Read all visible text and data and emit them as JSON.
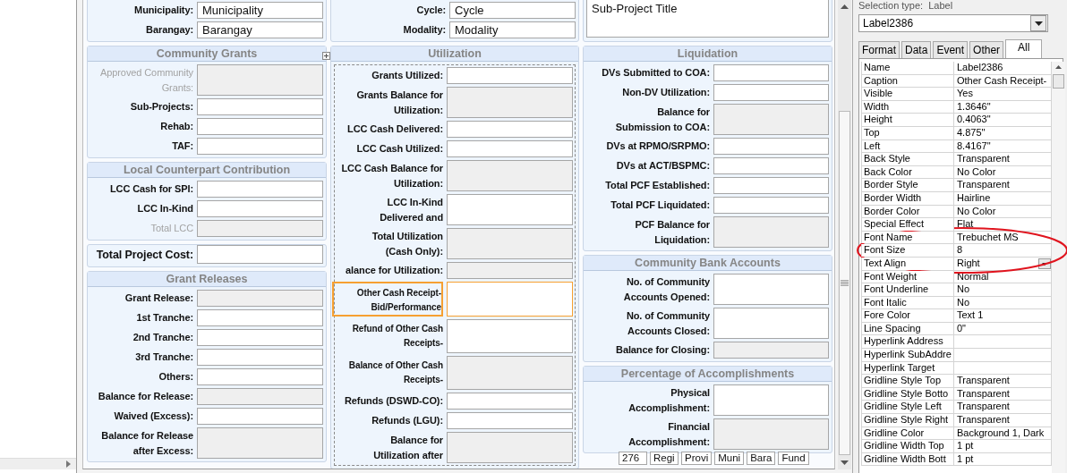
{
  "form": {
    "columns": [
      {
        "sections": [
          {
            "kind": "top",
            "subform": false,
            "rows": [
              {
                "label": "Municipality:",
                "kind": "normal",
                "field": {
                  "kind": "input",
                  "value": "Municipality"
                },
                "disabled": false,
                "selected": false
              },
              {
                "label": "Barangay:",
                "kind": "normal",
                "field": {
                  "kind": "input",
                  "value": "Barangay"
                },
                "disabled": false,
                "selected": false
              }
            ]
          },
          {
            "title": "Community Grants",
            "kind": "group",
            "subform": false,
            "rows": [
              {
                "label": "Approved Community\nGrants:",
                "kind": "normal",
                "field": {
                  "kind": "computed"
                },
                "disabled": true,
                "selected": false
              },
              {
                "label": "Sub-Projects:",
                "kind": "normal",
                "field": {
                  "kind": "input"
                },
                "disabled": false,
                "selected": false
              },
              {
                "label": "Rehab:",
                "kind": "normal",
                "field": {
                  "kind": "input"
                },
                "disabled": false,
                "selected": false
              },
              {
                "label": "TAF:",
                "kind": "normal",
                "field": {
                  "kind": "input"
                },
                "disabled": false,
                "selected": false
              }
            ]
          },
          {
            "title": "Local Counterpart Contribution",
            "kind": "group",
            "subform": false,
            "rows": [
              {
                "label": "LCC Cash for SPI:",
                "kind": "normal",
                "field": {
                  "kind": "input"
                },
                "disabled": false,
                "selected": false
              },
              {
                "label": "LCC In-Kind",
                "kind": "normal",
                "field": {
                  "kind": "input"
                },
                "disabled": false,
                "selected": false
              },
              {
                "label": "Total LCC",
                "kind": "normal",
                "field": {
                  "kind": "computed"
                },
                "disabled": true,
                "selected": false
              }
            ]
          },
          {
            "kind": "group",
            "subform": false,
            "rows": [
              {
                "label": "Total Project Cost:",
                "kind": "total",
                "field": {
                  "kind": "input"
                },
                "disabled": false,
                "selected": false
              }
            ]
          },
          {
            "title": "Grant Releases",
            "kind": "group",
            "subform": false,
            "rows": [
              {
                "label": "Grant Release:",
                "kind": "normal",
                "field": {
                  "kind": "computed"
                },
                "disabled": false,
                "selected": false
              },
              {
                "label": "1st Tranche:",
                "kind": "normal",
                "field": {
                  "kind": "input"
                },
                "disabled": false,
                "selected": false
              },
              {
                "label": "2nd Tranche:",
                "kind": "normal",
                "field": {
                  "kind": "input"
                },
                "disabled": false,
                "selected": false
              },
              {
                "label": "3rd Tranche:",
                "kind": "normal",
                "field": {
                  "kind": "input"
                },
                "disabled": false,
                "selected": false
              },
              {
                "label": "Others:",
                "kind": "normal",
                "field": {
                  "kind": "input"
                },
                "disabled": false,
                "selected": false
              },
              {
                "label": "Balance for Release:",
                "kind": "normal",
                "field": {
                  "kind": "computed"
                },
                "disabled": false,
                "selected": false
              },
              {
                "label": "Waived (Excess):",
                "kind": "normal",
                "field": {
                  "kind": "input"
                },
                "disabled": false,
                "selected": false
              },
              {
                "label": "Balance for Release\nafter Excess:",
                "kind": "normal",
                "field": {
                  "kind": "computed"
                },
                "disabled": false,
                "selected": false
              }
            ]
          }
        ]
      },
      {
        "sections": [
          {
            "kind": "top",
            "subform": false,
            "rows": [
              {
                "label": "Cycle:",
                "kind": "normal",
                "field": {
                  "kind": "input",
                  "value": "Cycle"
                },
                "disabled": false,
                "selected": false
              },
              {
                "label": "Modality:",
                "kind": "normal",
                "field": {
                  "kind": "input",
                  "value": "Modality"
                },
                "disabled": false,
                "selected": false
              }
            ]
          },
          {
            "title": "Utilization",
            "kind": "group",
            "subform": true,
            "rows": [
              {
                "label": "Grants Utilized:",
                "kind": "normal",
                "field": {
                  "kind": "input"
                },
                "disabled": false,
                "selected": false
              },
              {
                "label": "Grants Balance for\nUtilization:",
                "kind": "normal",
                "field": {
                  "kind": "computed"
                },
                "disabled": false,
                "selected": false
              },
              {
                "label": "LCC Cash Delivered:",
                "kind": "normal",
                "field": {
                  "kind": "input"
                },
                "disabled": false,
                "selected": false
              },
              {
                "label": "LCC Cash Utilized:",
                "kind": "normal",
                "field": {
                  "kind": "input"
                },
                "disabled": false,
                "selected": false
              },
              {
                "label": "LCC Cash Balance for\nUtilization:",
                "kind": "normal",
                "field": {
                  "kind": "computed"
                },
                "disabled": false,
                "selected": false
              },
              {
                "label": "LCC In-Kind\nDelivered and",
                "kind": "normal",
                "field": {
                  "kind": "input"
                },
                "disabled": false,
                "selected": false
              },
              {
                "label": "Total Utilization\n(Cash Only):",
                "kind": "normal",
                "field": {
                  "kind": "computed"
                },
                "disabled": false,
                "selected": false
              },
              {
                "label": "alance for Utilization:",
                "kind": "normal",
                "field": {
                  "kind": "computed"
                },
                "disabled": false,
                "selected": false
              },
              {
                "label": "Other Cash Receipt-\nBid/Performance",
                "kind": "small",
                "field": {
                  "kind": "input"
                },
                "disabled": false,
                "selected": true
              },
              {
                "label": "Refund of Other Cash\nReceipts-",
                "kind": "small",
                "field": {
                  "kind": "input"
                },
                "disabled": false,
                "selected": false
              },
              {
                "label": "Balance of Other Cash\nReceipts-",
                "kind": "small",
                "field": {
                  "kind": "computed"
                },
                "disabled": false,
                "selected": false
              },
              {
                "label": "Refunds (DSWD-CO):",
                "kind": "normal",
                "field": {
                  "kind": "input"
                },
                "disabled": false,
                "selected": false
              },
              {
                "label": "Refunds (LGU):",
                "kind": "normal",
                "field": {
                  "kind": "input"
                },
                "disabled": false,
                "selected": false
              },
              {
                "label": "Balance for\nUtilization after",
                "kind": "normal",
                "field": {
                  "kind": "computed"
                },
                "disabled": false,
                "selected": false
              }
            ]
          }
        ]
      },
      {
        "sections": [
          {
            "kind": "top",
            "subform": false,
            "rows": [
              {
                "field": {
                  "kind": "textarea",
                  "value": "Sub-Project Title"
                },
                "disabled": false,
                "selected": false
              }
            ]
          },
          {
            "title": "Liquidation",
            "kind": "group",
            "subform": false,
            "rows": [
              {
                "label": "DVs Submitted to COA:",
                "kind": "normal",
                "field": {
                  "kind": "input"
                },
                "disabled": false,
                "selected": false
              },
              {
                "label": "Non-DV Utilization:",
                "kind": "normal",
                "field": {
                  "kind": "input"
                },
                "disabled": false,
                "selected": false
              },
              {
                "label": "Balance for\nSubmission to COA:",
                "kind": "normal",
                "field": {
                  "kind": "computed"
                },
                "disabled": false,
                "selected": false
              },
              {
                "label": "DVs at RPMO/SRPMO:",
                "kind": "normal",
                "field": {
                  "kind": "input"
                },
                "disabled": false,
                "selected": false
              },
              {
                "label": "DVs at ACT/BSPMC:",
                "kind": "normal",
                "field": {
                  "kind": "input"
                },
                "disabled": false,
                "selected": false
              },
              {
                "label": "Total PCF Established:",
                "kind": "normal",
                "field": {
                  "kind": "input"
                },
                "disabled": false,
                "selected": false
              },
              {
                "label": "Total PCF Liquidated:",
                "kind": "normal",
                "field": {
                  "kind": "input"
                },
                "disabled": false,
                "selected": false
              },
              {
                "label": "PCF Balance for\nLiquidation:",
                "kind": "normal",
                "field": {
                  "kind": "computed"
                },
                "disabled": false,
                "selected": false
              }
            ]
          },
          {
            "title": "Community Bank Accounts",
            "kind": "group",
            "subform": false,
            "rows": [
              {
                "label": "No. of Community\nAccounts Opened:",
                "kind": "normal",
                "field": {
                  "kind": "input"
                },
                "disabled": false,
                "selected": false
              },
              {
                "label": "No. of Community\nAccounts Closed:",
                "kind": "normal",
                "field": {
                  "kind": "input"
                },
                "disabled": false,
                "selected": false
              },
              {
                "label": "Balance for Closing:",
                "kind": "normal",
                "field": {
                  "kind": "computed"
                },
                "disabled": false,
                "selected": false
              }
            ]
          },
          {
            "title": "Percentage of Accomplishments",
            "kind": "group",
            "subform": false,
            "rows": [
              {
                "label": "Physical\nAccomplishment:",
                "kind": "normal",
                "field": {
                  "kind": "input"
                },
                "disabled": false,
                "selected": false
              },
              {
                "label": "Financial\nAccomplishment:",
                "kind": "normal",
                "field": {
                  "kind": "computed"
                },
                "disabled": false,
                "selected": false
              }
            ]
          }
        ],
        "footer_fields": [
          "276",
          "Regi",
          "Provi",
          "Muni",
          "Bara",
          "Fund"
        ]
      }
    ]
  },
  "property_sheet": {
    "selection_type_label": "Selection type:",
    "selection_type": "Label",
    "object": "Label2386",
    "tabs": [
      {
        "label": "Format",
        "selected": false
      },
      {
        "label": "Data",
        "selected": false
      },
      {
        "label": "Event",
        "selected": false
      },
      {
        "label": "Other",
        "selected": false
      },
      {
        "label": "All",
        "selected": true
      }
    ],
    "properties": [
      {
        "name": "Name",
        "value": "Label2386",
        "selected": false
      },
      {
        "name": "Caption",
        "value": "Other Cash Receipt-",
        "selected": false
      },
      {
        "name": "Visible",
        "value": "Yes",
        "selected": false
      },
      {
        "name": "Width",
        "value": "1.3646\"",
        "selected": false
      },
      {
        "name": "Height",
        "value": "0.4063\"",
        "selected": false
      },
      {
        "name": "Top",
        "value": "4.875\"",
        "selected": false
      },
      {
        "name": "Left",
        "value": "8.4167\"",
        "selected": false
      },
      {
        "name": "Back Style",
        "value": "Transparent",
        "selected": false
      },
      {
        "name": "Back Color",
        "value": "No Color",
        "selected": false
      },
      {
        "name": "Border Style",
        "value": "Transparent",
        "selected": false
      },
      {
        "name": "Border Width",
        "value": "Hairline",
        "selected": false
      },
      {
        "name": "Border Color",
        "value": "No Color",
        "selected": false
      },
      {
        "name": "Special Effect",
        "value": "Flat",
        "selected": false
      },
      {
        "name": "Font Name",
        "value": "Trebuchet MS",
        "selected": false
      },
      {
        "name": "Font Size",
        "value": "8",
        "selected": false
      },
      {
        "name": "Text Align",
        "value": "Right",
        "selected": true
      },
      {
        "name": "Font Weight",
        "value": "Normal",
        "selected": false
      },
      {
        "name": "Font Underline",
        "value": "No",
        "selected": false
      },
      {
        "name": "Font Italic",
        "value": "No",
        "selected": false
      },
      {
        "name": "Fore Color",
        "value": "Text 1",
        "selected": false
      },
      {
        "name": "Line Spacing",
        "value": "0\"",
        "selected": false
      },
      {
        "name": "Hyperlink Address",
        "selected": false
      },
      {
        "name": "Hyperlink SubAddre",
        "selected": false
      },
      {
        "name": "Hyperlink Target",
        "selected": false
      },
      {
        "name": "Gridline Style Top",
        "value": "Transparent",
        "selected": false
      },
      {
        "name": "Gridline Style Botto",
        "value": "Transparent",
        "selected": false
      },
      {
        "name": "Gridline Style Left",
        "value": "Transparent",
        "selected": false
      },
      {
        "name": "Gridline Style Right",
        "value": "Transparent",
        "selected": false
      },
      {
        "name": "Gridline Color",
        "value": "Background 1, Dark",
        "selected": false
      },
      {
        "name": "Gridline Width Top",
        "value": "1 pt",
        "selected": false
      },
      {
        "name": "Gridline Width Bott",
        "value": "1 pt",
        "selected": false
      }
    ]
  }
}
